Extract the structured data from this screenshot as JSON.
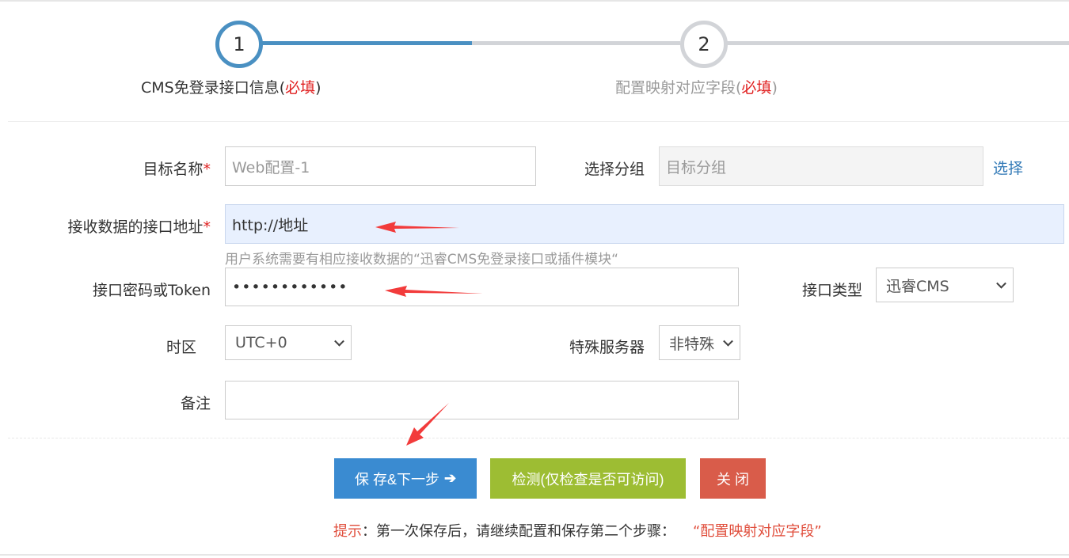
{
  "stepper": {
    "steps": [
      {
        "number": "1",
        "label": "CMS免登录接口信息(",
        "required": "必填",
        "suffix": ")"
      },
      {
        "number": "2",
        "label": "配置映射对应字段(",
        "required": "必填",
        "suffix": ")"
      }
    ]
  },
  "form": {
    "target_name": {
      "label": "目标名称",
      "star": "*",
      "placeholder": "Web配置-1"
    },
    "group": {
      "label": "选择分组",
      "placeholder": "目标分组",
      "link": "选择"
    },
    "endpoint": {
      "label": "接收数据的接口地址",
      "star": "*",
      "value": "http://地址",
      "hint": "用户系统需要有相应接收数据的“迅睿CMS免登录接口或插件模块“"
    },
    "token": {
      "label": "接口密码或Token",
      "value": "••••••••••••"
    },
    "api_type": {
      "label": "接口类型",
      "selected": "迅睿CMS"
    },
    "timezone": {
      "label": "时区",
      "selected": "UTC+0"
    },
    "special_server": {
      "label": "特殊服务器",
      "selected": "非特殊"
    },
    "note": {
      "label": "备注",
      "value": ""
    }
  },
  "buttons": {
    "save": "保 存&下一步",
    "save_icon": "➔",
    "check": "检测(仅检查是否可访问)",
    "close": "关 闭"
  },
  "tip": {
    "prefix": "提示",
    "text": "：第一次保存后，请继续配置和保存第二个步骤：",
    "highlight": "“配置映射对应字段”"
  },
  "colors": {
    "accent": "#4a90c2",
    "required": "#e02020",
    "save_button": "#3a8bd1",
    "check_button": "#9dbd33",
    "close_button": "#d95c4a"
  }
}
